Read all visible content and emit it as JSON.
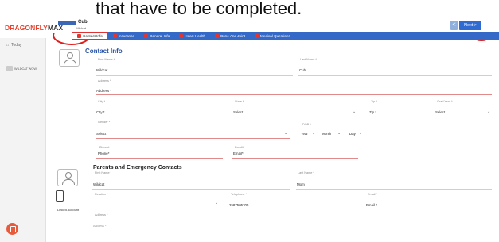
{
  "caption": "that have to be completed.",
  "app": {
    "logo_prefix": "DRAGONFLY",
    "logo_suffix": "MAX",
    "profile_name": "Cub",
    "profile_sub": "Wildcat"
  },
  "nav": {
    "next_label": "Next  >",
    "prev_label": "<"
  },
  "tabs": [
    {
      "label": "Contact Info",
      "active": true
    },
    {
      "label": "Insurance"
    },
    {
      "label": "General Info"
    },
    {
      "label": "Heart Health"
    },
    {
      "label": "Bone And Joint"
    },
    {
      "label": "Medical Questions"
    }
  ],
  "sidebar": {
    "today": "Today",
    "user": "WILDCAT WOW"
  },
  "contact": {
    "title": "Contact Info",
    "first_name_label": "First Name *",
    "first_name": "Wildcat",
    "last_name_label": "Last Name *",
    "last_name": "Cub",
    "address_label": "Address *",
    "address_placeholder": "Address *",
    "city_label": "City *",
    "city_placeholder": "City *",
    "state_label": "State *",
    "state_value": "Select",
    "zip_label": "Zip *",
    "zip_placeholder": "Zip *",
    "grad_label": "Grad Year *",
    "grad_value": "Select",
    "gender_label": "Gender *",
    "gender_value": "Select",
    "dob_label": "DOB *",
    "dob_year": "Year",
    "dob_month": "Month",
    "dob_day": "Day",
    "phone_label": "Phone*",
    "phone_placeholder": "Phone*",
    "email_label": "Email*",
    "email_placeholder": "Email*"
  },
  "parents": {
    "title": "Parents and Emergency Contacts",
    "first_name_label": "First Name *",
    "first_name": "Wildcat",
    "last_name_label": "Last Name *",
    "last_name": "Mom",
    "relation_label": "Relation *",
    "telephone_label": "Telephone *",
    "telephone": "2587505205",
    "email_label": "Email *",
    "email_placeholder": "Email *",
    "address_label": "Address *",
    "address_placeholder": "Address *",
    "linked_account": "Linked Account"
  },
  "colors": {
    "accent": "#3469c7",
    "required": "#e28a8a",
    "annotation": "#e21b1b"
  }
}
